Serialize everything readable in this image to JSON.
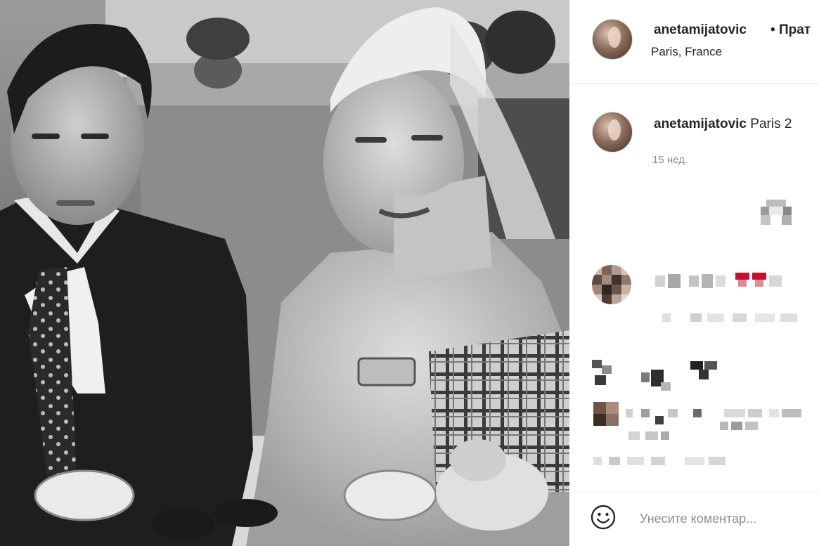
{
  "post": {
    "photo_label": "black-and-white photo of a couple at a table",
    "header": {
      "username": "anetamijatovic",
      "separator": "•",
      "follow_label": "Прат",
      "location": "Paris, France"
    },
    "caption": {
      "username": "anetamijatovic",
      "text": "Paris 2",
      "time": "15 нед."
    },
    "comment_input": {
      "placeholder": "Унесите коментар..."
    },
    "icons": {
      "emoji": "smiley-face-icon",
      "bookmark": "bookmark-icon"
    },
    "colors": {
      "text": "#262626",
      "muted": "#8e8e8e",
      "border": "#efefef",
      "censored_red": "#c8102e"
    }
  }
}
